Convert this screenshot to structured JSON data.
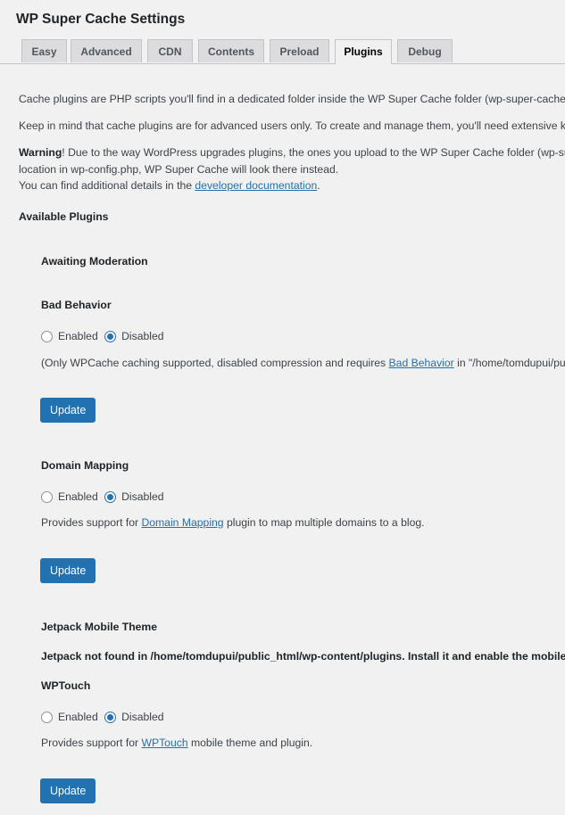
{
  "page_title": "WP Super Cache Settings",
  "tabs": [
    "Easy",
    "Advanced",
    "CDN",
    "Contents",
    "Preload",
    "Plugins",
    "Debug"
  ],
  "intro": {
    "line1": "Cache plugins are PHP scripts you'll find in a dedicated folder inside the WP Super Cache folder (wp-super-cache/p",
    "line2": "Keep in mind that cache plugins are for advanced users only. To create and manage them, you'll need extensive kn",
    "warning_label": "Warning",
    "warning_text": "! Due to the way WordPress upgrades plugins, the ones you upload to the WP Super Cache folder (wp-su",
    "warning_line2": "location in wp-config.php, WP Super Cache will look there instead.",
    "details_prefix": "You can find additional details in the ",
    "details_link": "developer documentation",
    "details_suffix": "."
  },
  "available_plugins_heading": "Available Plugins",
  "awaiting_moderation_heading": "Awaiting Moderation",
  "radio_enabled": "Enabled",
  "radio_disabled": "Disabled",
  "update_label": "Update",
  "bad_behavior": {
    "heading": "Bad Behavior",
    "desc_prefix": "(Only WPCache caching supported, disabled compression and requires ",
    "desc_link": "Bad Behavior",
    "desc_suffix": " in \"/home/tomdupui/pu"
  },
  "domain_mapping": {
    "heading": "Domain Mapping",
    "desc_prefix": "Provides support for ",
    "desc_link": "Domain Mapping",
    "desc_suffix": " plugin to map multiple domains to a blog."
  },
  "jetpack": {
    "heading": "Jetpack Mobile Theme",
    "notice": "Jetpack not found in /home/tomdupui/public_html/wp-content/plugins. Install it and enable the mobile th"
  },
  "wptouch": {
    "heading": "WPTouch",
    "desc_prefix": "Provides support for ",
    "desc_link": "WPTouch",
    "desc_suffix": " mobile theme and plugin."
  }
}
